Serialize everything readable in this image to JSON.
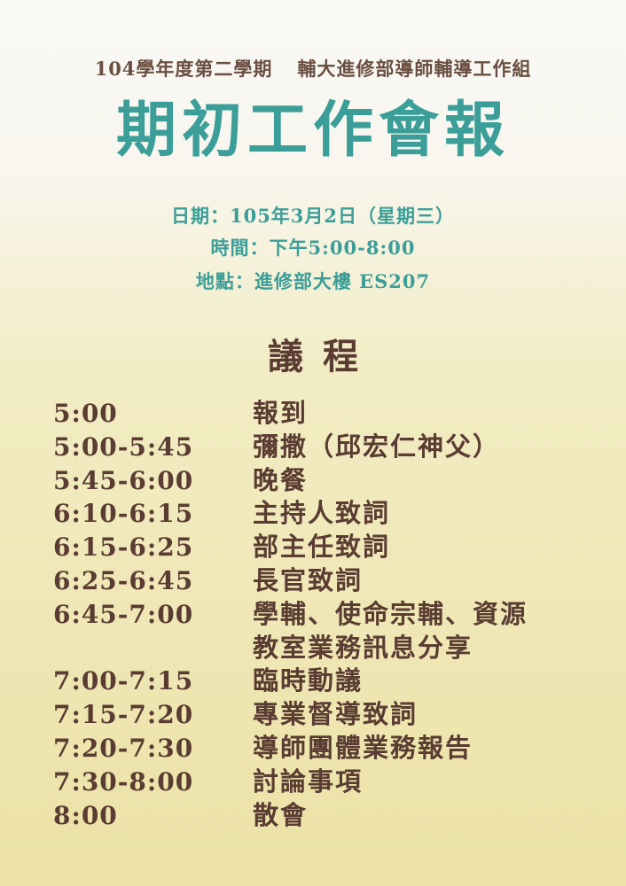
{
  "header": {
    "semester": "104學年度第二學期",
    "organization": "輔大進修部導師輔導工作組"
  },
  "title": "期初工作會報",
  "info": {
    "date": "日期：105年3月2日（星期三）",
    "time": "時間：下午5:00-8:00",
    "place": "地點：進修部大樓  ES207"
  },
  "agenda": {
    "title": "議程",
    "items": [
      {
        "time": "5:00",
        "item": "報到"
      },
      {
        "time": "5:00-5:45",
        "item": "彌撒（邱宏仁神父）"
      },
      {
        "time": "5:45-6:00",
        "item": "晚餐"
      },
      {
        "time": "6:10-6:15",
        "item": "主持人致詞"
      },
      {
        "time": "6:15-6:25",
        "item": "部主任致詞"
      },
      {
        "time": "6:25-6:45",
        "item": "長官致詞"
      },
      {
        "time": "6:45-7:00",
        "item_line1": "學輔、使命宗輔、資源",
        "item_line2": "教室業務訊息分享"
      },
      {
        "time": "7:00-7:15",
        "item": "臨時動議"
      },
      {
        "time": "7:15-7:20",
        "item": "專業督導致詞"
      },
      {
        "time": "7:20-7:30",
        "item": "導師團體業務報告"
      },
      {
        "time": "7:30-8:00",
        "item": "討論事項"
      },
      {
        "time": "8:00",
        "item": "散會"
      }
    ]
  },
  "colors": {
    "teal": "#3c9e98",
    "brown": "#5a3c32",
    "header_brown": "#6a4f42"
  }
}
